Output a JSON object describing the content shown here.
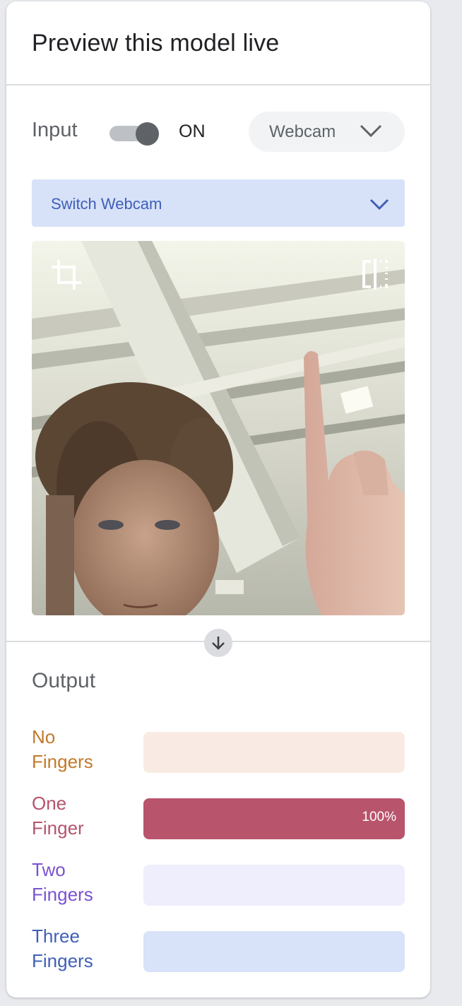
{
  "panel": {
    "title": "Preview this model live"
  },
  "input": {
    "label": "Input",
    "toggle_state": "ON",
    "toggle_on": true,
    "source": "Webcam",
    "switch_webcam": "Switch Webcam"
  },
  "output": {
    "title": "Output",
    "classes": [
      {
        "line1": "No",
        "line2": "Fingers",
        "confidence": 0.0,
        "pct_label": "",
        "label_color": "#c27a2c",
        "bg_color": "#f9ebe3",
        "fill_color": "#e8a36d"
      },
      {
        "line1": "One",
        "line2": "Finger",
        "confidence": 1.0,
        "pct_label": "100%",
        "label_color": "#b4546c",
        "bg_color": "#f7dde3",
        "fill_color": "#b8546c"
      },
      {
        "line1": "Two",
        "line2": "Fingers",
        "confidence": 0.0,
        "pct_label": "",
        "label_color": "#7b52d1",
        "bg_color": "#efeefc",
        "fill_color": "#8b6fe0"
      },
      {
        "line1": "Three",
        "line2": "Fingers",
        "confidence": 0.0,
        "pct_label": "",
        "label_color": "#3f60b8",
        "bg_color": "#d8e2f8",
        "fill_color": "#4a6cc8"
      }
    ]
  },
  "icons": {
    "crop": "crop-icon",
    "flip": "flip-icon",
    "chevron": "chevron-down-icon",
    "arrow": "arrow-down-icon"
  }
}
